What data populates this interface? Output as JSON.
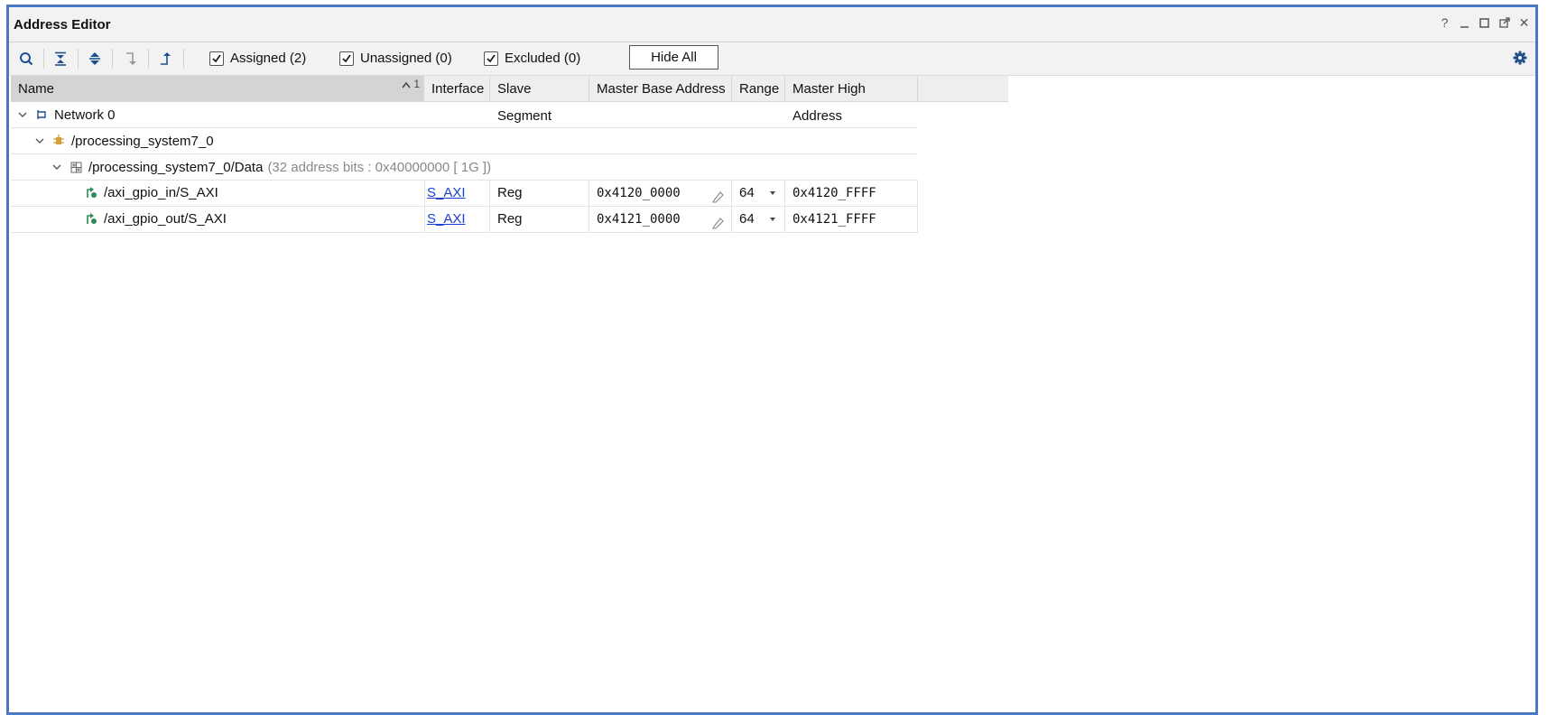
{
  "window": {
    "title": "Address Editor"
  },
  "window_controls": {
    "help": "?",
    "close": "✕"
  },
  "toolbar": {
    "buttons": [
      "search-icon",
      "collapse-all-icon",
      "expand-all-icon",
      "assign-icon",
      "unassign-icon"
    ],
    "filters": [
      {
        "label": "Assigned (2)",
        "checked": true
      },
      {
        "label": "Unassigned (0)",
        "checked": true
      },
      {
        "label": "Excluded (0)",
        "checked": true
      }
    ],
    "hide_all_label": "Hide All"
  },
  "table": {
    "headers": {
      "name": "Name",
      "sort_index": "1",
      "interface": "Interface",
      "slave_segment": "Slave Segment",
      "master_base_address": "Master Base Address",
      "range": "Range",
      "master_high_address": "Master High Address"
    },
    "network": {
      "label": "Network 0"
    },
    "master": {
      "label": "/processing_system7_0"
    },
    "space": {
      "label": "/processing_system7_0/Data",
      "info": "(32 address bits : 0x40000000 [ 1G ])"
    },
    "rows": [
      {
        "name": "/axi_gpio_in/S_AXI",
        "interface": "S_AXI",
        "slave_segment": "Reg",
        "master_base_address": "0x4120_0000",
        "range": "64",
        "master_high_address": "0x4120_FFFF"
      },
      {
        "name": "/axi_gpio_out/S_AXI",
        "interface": "S_AXI",
        "slave_segment": "Reg",
        "master_base_address": "0x4121_0000",
        "range": "64",
        "master_high_address": "0x4121_FFFF"
      }
    ]
  },
  "colors": {
    "window_border": "#4a78c4",
    "link": "#1a3fd6",
    "accent_icon": "#1f4f8f",
    "slave_icon": "#2e8b57",
    "master_icon": "#d4a03a"
  }
}
